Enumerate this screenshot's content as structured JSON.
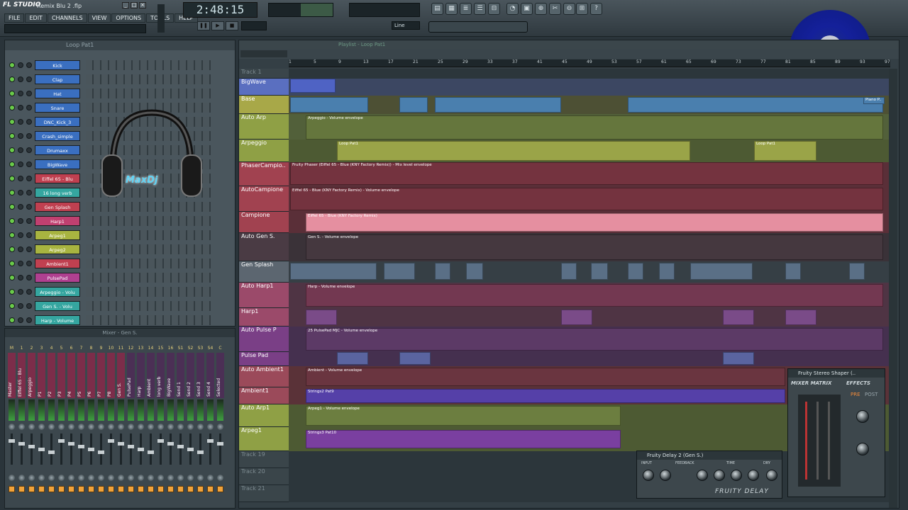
{
  "app": {
    "logo": "FL STUDIO",
    "file": "Remix Blu 2 .flp",
    "time": "2:48:15"
  },
  "menu": [
    "FILE",
    "EDIT",
    "CHANNELS",
    "VIEW",
    "OPTIONS",
    "TOOLS",
    "HELP"
  ],
  "transport": {
    "snap_label": "Line"
  },
  "rack": {
    "title": "Loop Pat1",
    "channels": [
      {
        "name": "Kick",
        "color": "#3a6fc0"
      },
      {
        "name": "Clap",
        "color": "#3a6fc0"
      },
      {
        "name": "Hat",
        "color": "#3a6fc0"
      },
      {
        "name": "Snare",
        "color": "#3a6fc0"
      },
      {
        "name": "DNC_Kick_3",
        "color": "#3a6fc0"
      },
      {
        "name": "Crash_simple",
        "color": "#3a6fc0"
      },
      {
        "name": "Drumaxx",
        "color": "#3a6fc0"
      },
      {
        "name": "BigWave",
        "color": "#3a6fc0"
      },
      {
        "name": "Eiffel 65 - Blu",
        "color": "#c04050"
      },
      {
        "name": "16 long verb",
        "color": "#35a6a0"
      },
      {
        "name": "Gen Splash",
        "color": "#c04050"
      },
      {
        "name": "Harp1",
        "color": "#c04070"
      },
      {
        "name": "Arpeg1",
        "color": "#a8b440"
      },
      {
        "name": "Arpeg2",
        "color": "#a8b440"
      },
      {
        "name": "Ambient1",
        "color": "#c04050"
      },
      {
        "name": "PulsePad",
        "color": "#b04090"
      },
      {
        "name": "Arpeggio - Volu",
        "color": "#35a6a0"
      },
      {
        "name": "Gen S. - Volu",
        "color": "#35a6a0"
      },
      {
        "name": "Harp - Volume",
        "color": "#35a6a0"
      }
    ],
    "logo_text": "MaxDj"
  },
  "mixer": {
    "title": "Mixer - Gen S.",
    "tracks": [
      "Master",
      "Eiffel 65 - Blu",
      "Arpeggio",
      "P1",
      "P2",
      "P3",
      "P4",
      "P5",
      "P6",
      "P7",
      "P8",
      "Gen S.",
      "PulsePad",
      "Harp",
      "Ambient",
      "long verb",
      "BigWave",
      "Send 1",
      "Send 2",
      "Send 3",
      "Send 4",
      "Selected"
    ],
    "numbers": [
      "M",
      "1",
      "2",
      "3",
      "4",
      "5",
      "6",
      "7",
      "8",
      "9",
      "10",
      "11",
      "12",
      "13",
      "14",
      "15",
      "16",
      "S1",
      "S2",
      "S3",
      "S4",
      "C"
    ]
  },
  "playlist": {
    "title": "Playlist - Loop Pat1",
    "ticks": [
      "1",
      "5",
      "9",
      "13",
      "17",
      "21",
      "25",
      "29",
      "33",
      "37",
      "41",
      "45",
      "49",
      "53",
      "57",
      "61",
      "65",
      "69",
      "73",
      "77",
      "81",
      "85",
      "89",
      "93",
      "97"
    ],
    "tracks": [
      {
        "name": "Track 1",
        "dim": true
      },
      {
        "name": "BigWave"
      },
      {
        "name": "Base"
      },
      {
        "name": "Auto Arp"
      },
      {
        "name": "Arpeggio"
      },
      {
        "name": "PhaserCampio.."
      },
      {
        "name": "AutoCampione"
      },
      {
        "name": "Campione"
      },
      {
        "name": "Auto Gen S."
      },
      {
        "name": "Gen Splash"
      },
      {
        "name": "Auto Harp1"
      },
      {
        "name": "Harp1"
      },
      {
        "name": "Auto Pulse P"
      },
      {
        "name": "Pulse Pad"
      },
      {
        "name": "Auto Ambient1"
      },
      {
        "name": "Ambient1"
      },
      {
        "name": "Auto Arp1"
      },
      {
        "name": "Arpeg1"
      },
      {
        "name": "Track 19",
        "dim": true
      },
      {
        "name": "Track 20",
        "dim": true
      },
      {
        "name": "Track 21",
        "dim": true
      }
    ],
    "clips": {
      "auto_arp": "Arpeggio - Volume envelope",
      "loop_pat1": "Loop Pat1",
      "phaser": "Fruity Phaser (Eiffel 65 - Blue (KNY Factory Remix)) - Mix level envelope",
      "autocamp": "Eiffel 65 - Blue (KNY Factory Remix) - Volume envelope",
      "campione": "Eiffel 65 - Blue (KNY Factory Remix)",
      "auto_gen": "Gen S. - Volume envelope",
      "auto_harp": "Harp - Volume envelope",
      "auto_pulse": "25 PulsePad MJC - Volume envelope",
      "auto_ambient": "Ambient - Volume envelope",
      "ambient_pat": "Strings2 Pat9",
      "auto_arp1": "Arpeg1 - Volume envelope",
      "arpeg1_pat": "Strings3 Pat10",
      "piano": "Piano P.."
    }
  },
  "delay": {
    "title": "Fruity Delay 2 (Gen S.)",
    "sections": [
      "INPUT",
      "FEEDBACK",
      "TIME",
      "DRY"
    ],
    "brand": "FRUITY DELAY"
  },
  "shaper": {
    "title": "Fruity Stereo Shaper (..",
    "matrix": "MIXER MATRIX",
    "effects": "EFFECTS",
    "pre": "PRE",
    "post": "POST"
  },
  "vinyl": {
    "label": "blue"
  }
}
